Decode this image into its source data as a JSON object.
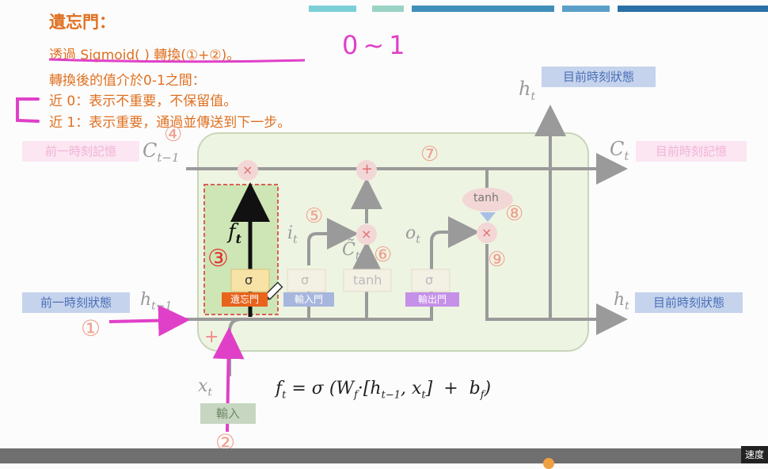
{
  "slide": {
    "title": "遺忘門：",
    "lines": [
      "透過 Sigmoid( ) 轉換(①+②)。",
      "轉換後的值介於0-1之間：",
      "近 0：表示不重要，不保留值。",
      "近 1：表示重要，通過並傳送到下一步。"
    ],
    "handwriting": "0~1"
  },
  "diagram": {
    "h_top": "目前時刻狀態",
    "h_right": "目前時刻狀態",
    "h_left": "前一時刻狀態",
    "c_left": "前一時刻記憶",
    "c_right": "目前時刻記憶",
    "input": "輸入",
    "forget_tag": "遺忘門",
    "input_tag": "輸入門",
    "output_tag": "輸出門",
    "sigma": "σ",
    "tanh": "tanh",
    "times": "×",
    "plus": "+",
    "numbers": [
      "①",
      "②",
      "③",
      "④",
      "⑤",
      "⑥",
      "⑦",
      "⑧",
      "⑨"
    ],
    "formula": "f_t = σ (W_f·[h_{t−1}, x_t] + b_f)"
  },
  "ui": {
    "speed_button": "速度"
  },
  "colors": {
    "accent_orange": "#e07020",
    "annotation_pink": "#e040c8",
    "circle_number": "#f0a090",
    "cell_bg": "#eef4e2",
    "arrow_gray": "#9a9a9a"
  }
}
